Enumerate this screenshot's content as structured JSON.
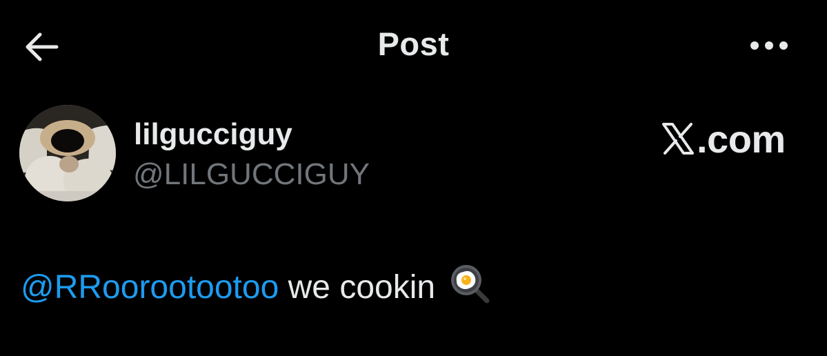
{
  "header": {
    "title": "Post",
    "back_icon": "arrow-left-icon",
    "more_icon": "more-horizontal-icon"
  },
  "author": {
    "display_name": "lilgucciguy",
    "handle": "@LILGUCCIGUY"
  },
  "watermark": {
    "text": ".com",
    "logo": "x-logo-icon"
  },
  "post": {
    "mention": "@RRoorootootoo",
    "text": " we cookin",
    "emoji": "cooking-egg-pan-icon"
  },
  "colors": {
    "background": "#000000",
    "text": "#e7e9ea",
    "secondary": "#71767b",
    "link": "#1d9bf0"
  }
}
